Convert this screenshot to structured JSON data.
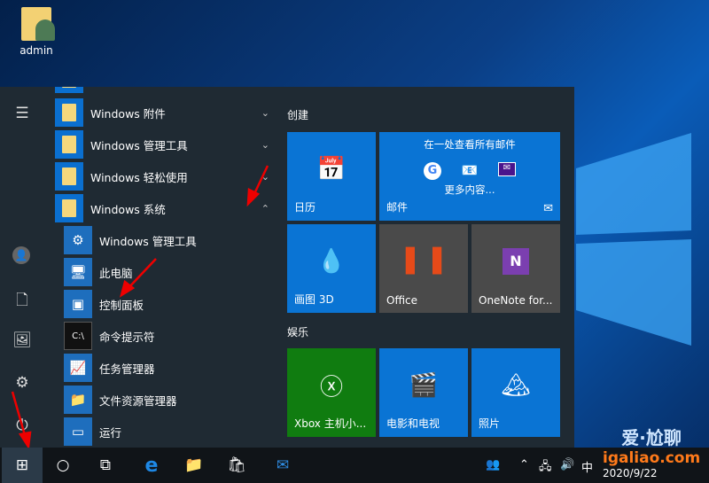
{
  "desktop": {
    "icons": [
      {
        "label": "admin"
      }
    ]
  },
  "start_menu": {
    "apps": [
      {
        "label": "Windows 附件",
        "type": "folder",
        "expanded": false
      },
      {
        "label": "Windows 管理工具",
        "type": "folder",
        "expanded": false
      },
      {
        "label": "Windows 轻松使用",
        "type": "folder",
        "expanded": false
      },
      {
        "label": "Windows 系统",
        "type": "folder",
        "expanded": true
      },
      {
        "label": "Windows 管理工具",
        "icon": "admin-tools-icon"
      },
      {
        "label": "此电脑",
        "icon": "computer-icon"
      },
      {
        "label": "控制面板",
        "icon": "control-panel-icon"
      },
      {
        "label": "命令提示符",
        "icon": "cmd-icon"
      },
      {
        "label": "任务管理器",
        "icon": "task-manager-icon"
      },
      {
        "label": "文件资源管理器",
        "icon": "file-explorer-icon"
      },
      {
        "label": "运行",
        "icon": "run-icon"
      }
    ],
    "groups": [
      {
        "label": "创建"
      },
      {
        "label": "娱乐"
      }
    ],
    "tiles": {
      "calendar": "日历",
      "mail": "邮件",
      "mail_headline": "在一处查看所有邮件",
      "mail_more": "更多内容...",
      "paint3d": "画图 3D",
      "office": "Office",
      "onenote": "OneNote for...",
      "xbox": "Xbox 主机小...",
      "movies": "电影和电视",
      "photos": "照片"
    },
    "colors": {
      "tile_blue": "#0a74d4",
      "tile_gray": "#4a4a4a",
      "xbox_green": "#107c10"
    }
  },
  "taskbar": {
    "ime": "中",
    "date": "2020/9/22"
  },
  "watermark": {
    "text": "爱·尬聊",
    "url": "igaliao.com"
  }
}
